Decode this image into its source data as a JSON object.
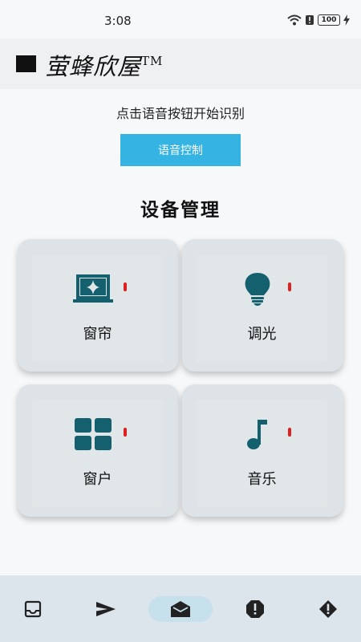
{
  "status_bar": {
    "time": "3:08",
    "battery": "100"
  },
  "header": {
    "title": "萤蜂欣屋",
    "trademark": "TM"
  },
  "voice": {
    "hint": "点击语音按钮开始识别",
    "button_label": "语音控制"
  },
  "section": {
    "title": "设备管理"
  },
  "devices": [
    {
      "label": "窗帘",
      "icon": "curtain-icon",
      "status": "off"
    },
    {
      "label": "调光",
      "icon": "lightbulb-icon",
      "status": "off"
    },
    {
      "label": "窗户",
      "icon": "window-icon",
      "status": "off"
    },
    {
      "label": "音乐",
      "icon": "music-note-icon",
      "status": "off"
    }
  ],
  "bottom_nav": [
    {
      "icon": "inbox-icon",
      "active": false
    },
    {
      "icon": "send-icon",
      "active": false
    },
    {
      "icon": "drafts-icon",
      "active": true
    },
    {
      "icon": "report-icon",
      "active": false
    },
    {
      "icon": "alert-icon",
      "active": false
    }
  ],
  "colors": {
    "accent": "#35b4e3",
    "icon": "#14606f",
    "indicator": "#e02020",
    "card": "#dde3e6"
  }
}
